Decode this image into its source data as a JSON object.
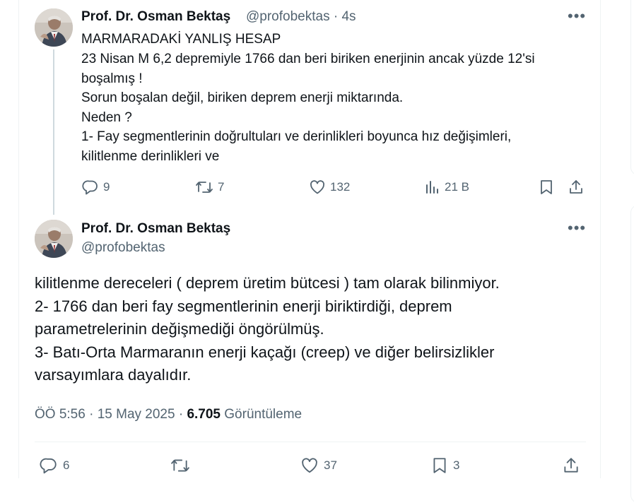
{
  "parent_tweet": {
    "author_name": "Prof. Dr. Osman Bektaş",
    "handle_time": "@profobektas · 4s",
    "lines": [
      "MARMARADAKİ YANLIŞ HESAP",
      "23 Nisan M 6,2 depremiyle 1766 dan beri biriken enerjinin ancak yüzde 12'si",
      "boşalmış !",
      "Sorun boşalan değil, biriken deprem enerji miktarında.",
      "Neden ?",
      "1- Fay segmentlerinin doğrultuları ve derinlikleri boyunca hız değişimleri,",
      "kilitlenme derinlikleri ve"
    ],
    "replies": "9",
    "retweets": "7",
    "likes": "132",
    "views": "21 B"
  },
  "main_tweet": {
    "author_name": "Prof. Dr. Osman Bektaş",
    "handle": "@profobektas",
    "lines": [
      "kilitlenme dereceleri ( deprem üretim bütcesi ) tam olarak bilinmiyor.",
      "2- 1766 dan beri fay segmentlerinin enerji biriktirdiği, deprem",
      "parametrelerinin değişmediği öngörülmüş.",
      "3- Batı-Orta Marmaranın enerji kaçağı (creep) ve diğer belirsizlikler",
      "varsayımlara dayalıdır."
    ],
    "time_date": "ÖÖ 5:56 · 15 May 2025 · ",
    "views_count": "6.705",
    "views_label": " Görüntüleme",
    "replies": "6",
    "likes": "37",
    "bookmarks": "3"
  },
  "icons": {
    "more": "more-dots-icon",
    "reply": "reply-icon",
    "retweet": "retweet-icon",
    "like": "heart-icon",
    "views": "views-icon",
    "bookmark": "bookmark-icon",
    "share": "share-icon"
  },
  "colors": {
    "text": "#0f1419",
    "secondary": "#536471",
    "border": "#eff3f4",
    "thread_line": "#cfd9de"
  }
}
